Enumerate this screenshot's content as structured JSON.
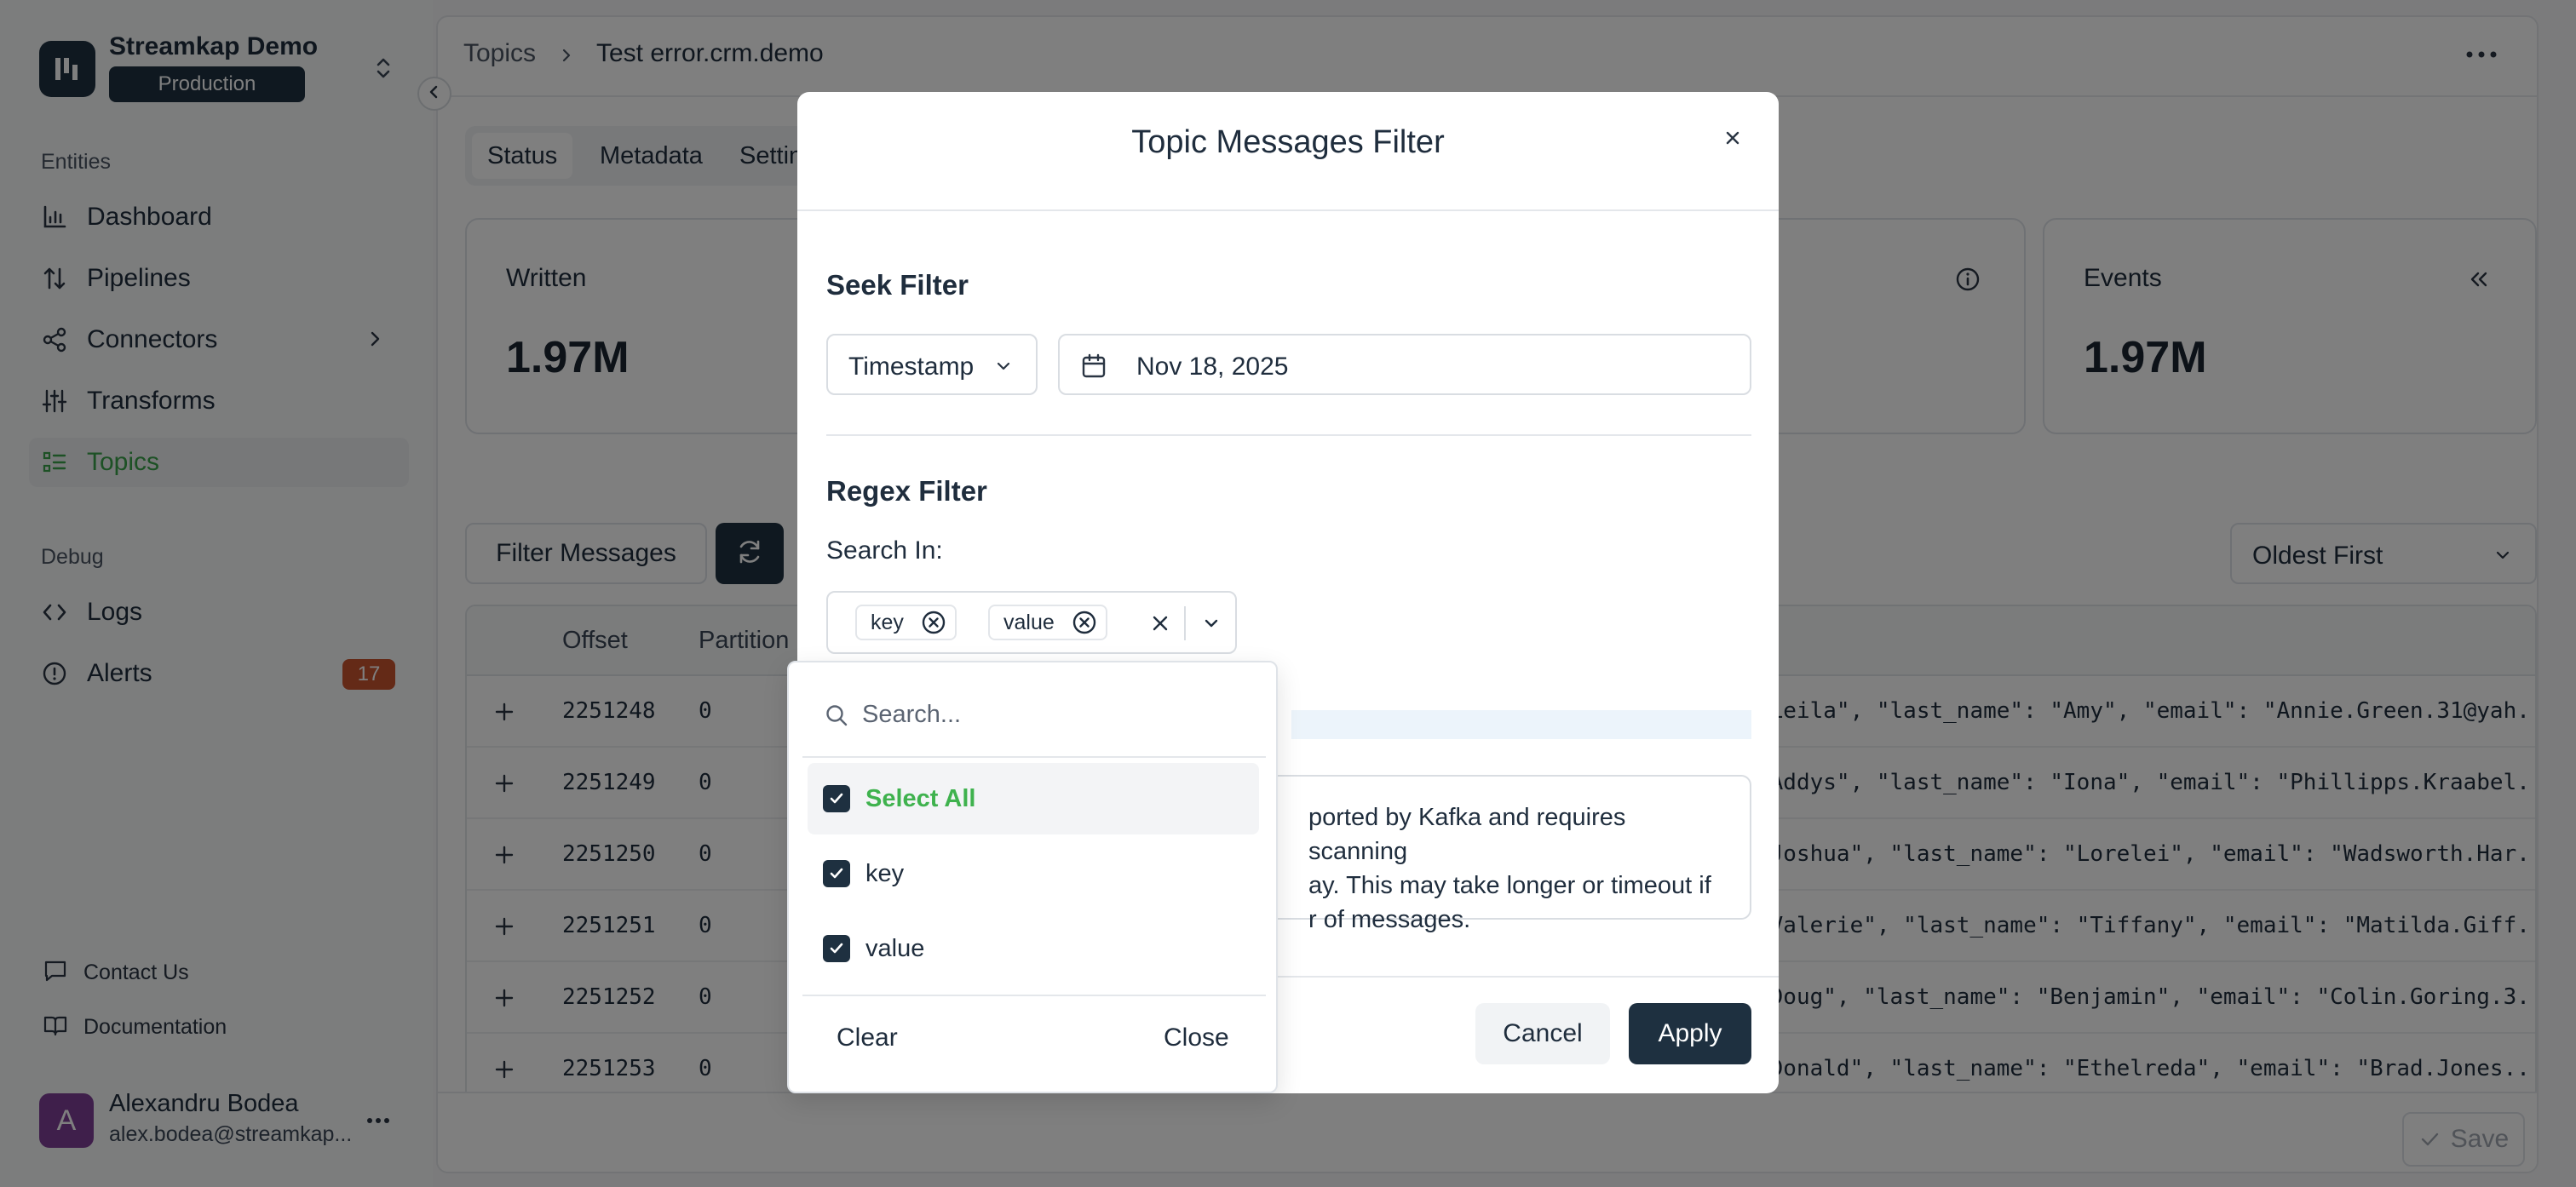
{
  "org": {
    "name": "Streamkap Demo",
    "environment": "Production"
  },
  "sidebar": {
    "entities_label": "Entities",
    "entities": [
      {
        "label": "Dashboard",
        "icon": "bar-chart-icon"
      },
      {
        "label": "Pipelines",
        "icon": "arrows-up-down-icon"
      },
      {
        "label": "Connectors",
        "icon": "share-nodes-icon"
      },
      {
        "label": "Transforms",
        "icon": "sliders-icon"
      },
      {
        "label": "Topics",
        "icon": "list-icon",
        "active": true
      }
    ],
    "debug_label": "Debug",
    "debug": [
      {
        "label": "Logs",
        "icon": "code-icon"
      },
      {
        "label": "Alerts",
        "icon": "alert-circle-icon",
        "badge": "17"
      }
    ],
    "footer": [
      {
        "label": "Contact Us",
        "icon": "message-icon"
      },
      {
        "label": "Documentation",
        "icon": "book-icon"
      }
    ],
    "user": {
      "initial": "A",
      "name": "Alexandru Bodea",
      "email": "alex.bodea@streamkap..."
    }
  },
  "breadcrumb": [
    "Topics",
    "Test error.crm.demo"
  ],
  "tabs": [
    "Status",
    "Metadata",
    "Settin"
  ],
  "stats": [
    {
      "title": "Written",
      "value": "1.97M"
    },
    {
      "title": "Events",
      "value": "1.97M"
    }
  ],
  "toolbar": {
    "filter_label": "Filter Messages",
    "sort_value": "Oldest First"
  },
  "table": {
    "columns": [
      "Offset",
      "Partition"
    ],
    "rows": [
      {
        "offset": "2251248",
        "partition": "0",
        "value": "\"Leila\", \"last_name\": \"Amy\", \"email\": \"Annie.Green.31@yah..."
      },
      {
        "offset": "2251249",
        "partition": "0",
        "value": "\"Addys\", \"last_name\": \"Iona\", \"email\": \"Phillipps.Kraabel..."
      },
      {
        "offset": "2251250",
        "partition": "0",
        "value": "\"Joshua\", \"last_name\": \"Lorelei\", \"email\": \"Wadsworth.Har..."
      },
      {
        "offset": "2251251",
        "partition": "0",
        "value": "\"Valerie\", \"last_name\": \"Tiffany\", \"email\": \"Matilda.Giff..."
      },
      {
        "offset": "2251252",
        "partition": "0",
        "value": "\"Doug\", \"last_name\": \"Benjamin\", \"email\": \"Colin.Goring.3..."
      },
      {
        "offset": "2251253",
        "partition": "0",
        "value": "\"Donald\", \"last_name\": \"Ethelreda\", \"email\": \"Brad.Jones...."
      }
    ]
  },
  "save_label": "Save",
  "modal": {
    "title": "Topic Messages Filter",
    "seek_title": "Seek Filter",
    "seek_type": "Timestamp",
    "seek_date": "Nov 18, 2025",
    "regex_title": "Regex Filter",
    "search_in_label": "Search In:",
    "chips": [
      "key",
      "value"
    ],
    "warning_lines": [
      "ported by Kafka and requires scanning",
      "ay. This may take longer or timeout if",
      "r of messages."
    ],
    "cancel_label": "Cancel",
    "apply_label": "Apply"
  },
  "dropdown": {
    "search_placeholder": "Search...",
    "options": [
      {
        "label": "Select All",
        "checked": true
      },
      {
        "label": "key",
        "checked": true
      },
      {
        "label": "value",
        "checked": true
      }
    ],
    "clear_label": "Clear",
    "close_label": "Close"
  },
  "colors": {
    "brand_dark": "#1e3040",
    "accent_green": "#3aa24a",
    "alert_badge": "#c9542e"
  }
}
